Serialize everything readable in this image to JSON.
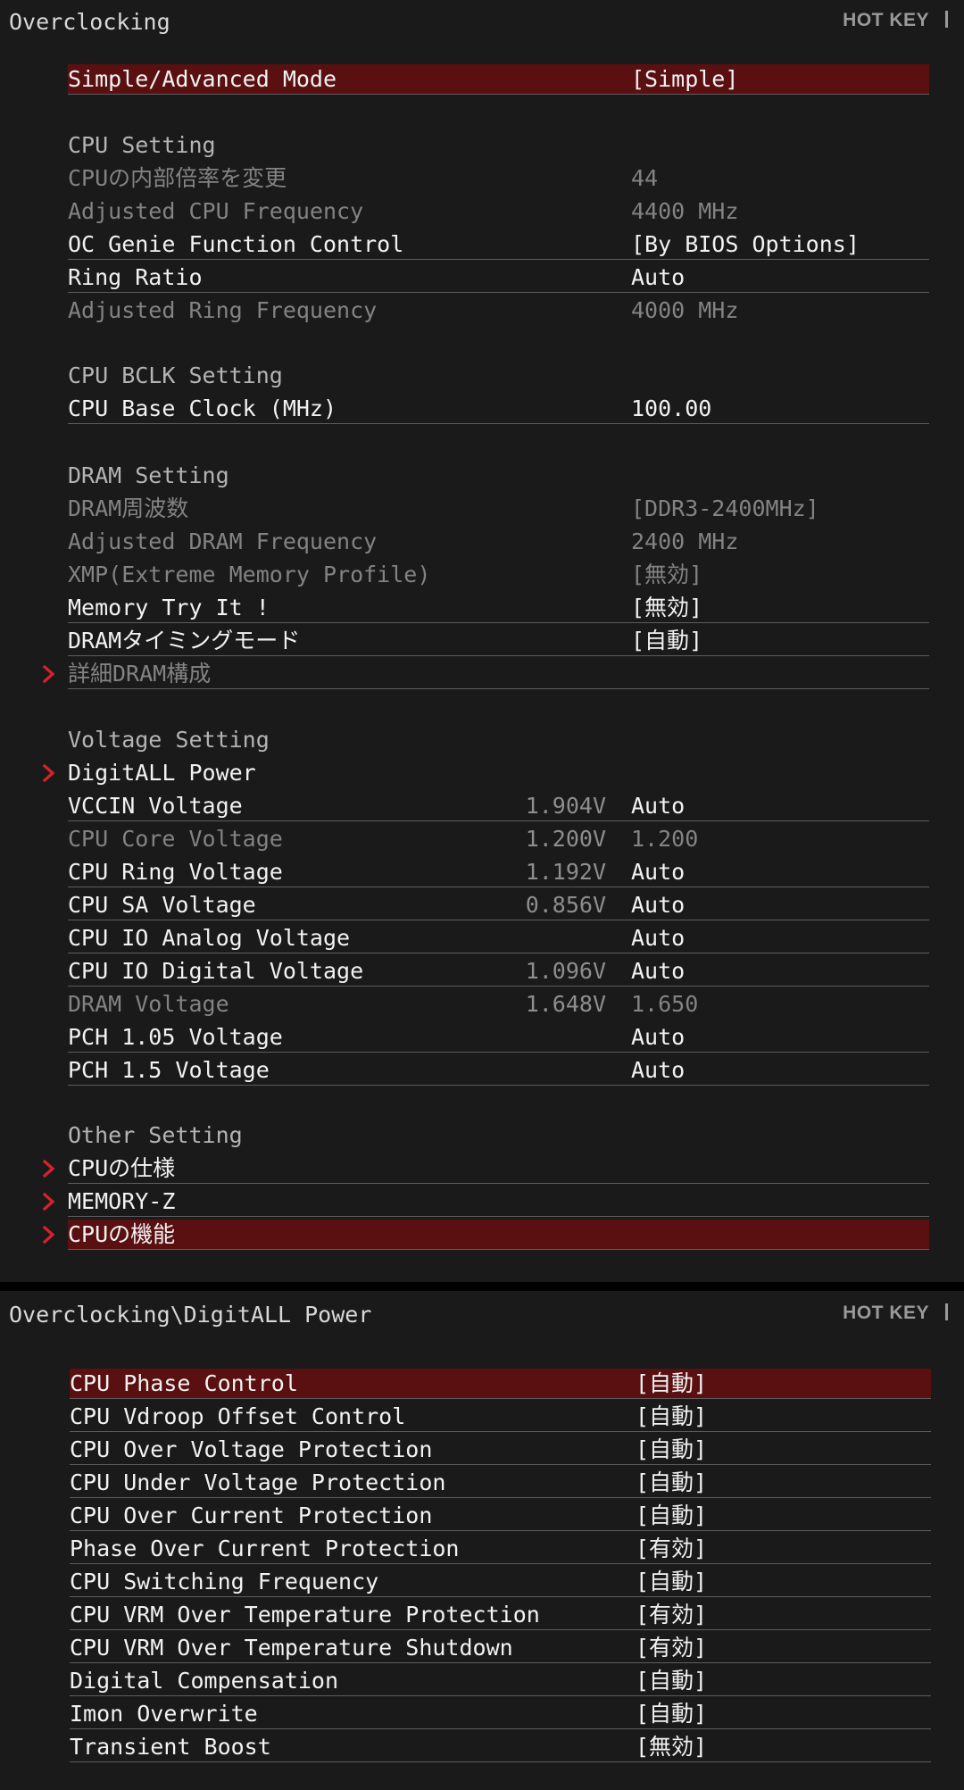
{
  "colors": {
    "panel_bg": "#1a1a1a",
    "selected_bg": "#5a1010",
    "chevron_red": "#d8222a",
    "text_active": "#f2f2f2",
    "text_disabled": "#838383"
  },
  "top_panel": {
    "title": "Overclocking",
    "hotkey": "HOT KEY"
  },
  "bottom_panel": {
    "title": "Overclocking\\DigitALL Power",
    "hotkey": "HOT KEY"
  },
  "settings": {
    "mode": {
      "label": "Simple/Advanced Mode",
      "value": "[Simple]"
    },
    "cpu_header": "CPU Setting",
    "cpu_ratio": {
      "label": "CPUの内部倍率を変更",
      "value": "44"
    },
    "adj_cpu_freq": {
      "label": "Adjusted CPU Frequency",
      "value": "4400 MHz"
    },
    "oc_genie": {
      "label": "OC Genie Function Control",
      "value": "[By BIOS Options]"
    },
    "ring_ratio": {
      "label": "Ring Ratio",
      "value": "Auto"
    },
    "adj_ring_freq": {
      "label": "Adjusted Ring Frequency",
      "value": "4000 MHz"
    },
    "bclk_header": "CPU BCLK Setting",
    "base_clock": {
      "label": "CPU Base Clock (MHz)",
      "value": "100.00"
    },
    "dram_header": "DRAM Setting",
    "dram_freq": {
      "label": "DRAM周波数",
      "value": "[DDR3-2400MHz]"
    },
    "adj_dram_freq": {
      "label": "Adjusted DRAM Frequency",
      "value": "2400 MHz"
    },
    "xmp": {
      "label": "XMP(Extreme Memory Profile)",
      "value": "[無効]"
    },
    "memory_try": {
      "label": "Memory Try It !",
      "value": "[無効]"
    },
    "dram_timing": {
      "label": "DRAMタイミングモード",
      "value": "[自動]"
    },
    "adv_dram": {
      "label": "詳細DRAM構成"
    },
    "voltage_header": "Voltage Setting",
    "digitall_power": {
      "label": "DigitALL Power"
    },
    "vccin": {
      "label": "VCCIN Voltage",
      "current": "1.904V",
      "value": "Auto"
    },
    "cpu_core_v": {
      "label": "CPU Core Voltage",
      "current": "1.200V",
      "value": "1.200"
    },
    "cpu_ring_v": {
      "label": "CPU Ring Voltage",
      "current": "1.192V",
      "value": "Auto"
    },
    "cpu_sa_v": {
      "label": "CPU SA Voltage",
      "current": "0.856V",
      "value": "Auto"
    },
    "cpu_io_analog": {
      "label": "CPU IO Analog Voltage",
      "current": "",
      "value": "Auto"
    },
    "cpu_io_digital": {
      "label": "CPU IO Digital Voltage",
      "current": "1.096V",
      "value": "Auto"
    },
    "dram_v": {
      "label": "DRAM Voltage",
      "current": "1.648V",
      "value": "1.650"
    },
    "pch_105": {
      "label": "PCH 1.05 Voltage",
      "current": "",
      "value": "Auto"
    },
    "pch_15": {
      "label": "PCH 1.5 Voltage",
      "current": "",
      "value": "Auto"
    },
    "other_header": "Other Setting",
    "cpu_spec": {
      "label": "CPUの仕様"
    },
    "memory_z": {
      "label": "MEMORY-Z"
    },
    "cpu_features": {
      "label": "CPUの機能"
    }
  },
  "digitall": {
    "phase_control": {
      "label": "CPU Phase Control",
      "value": "[自動]"
    },
    "vdroop": {
      "label": "CPU Vdroop Offset Control",
      "value": "[自動]"
    },
    "ovp": {
      "label": "CPU Over Voltage Protection",
      "value": "[自動]"
    },
    "uvp": {
      "label": "CPU Under Voltage Protection",
      "value": "[自動]"
    },
    "ocp": {
      "label": "CPU Over Current Protection",
      "value": "[自動]"
    },
    "phase_ocp": {
      "label": "Phase Over Current Protection",
      "value": "[有効]"
    },
    "switching_freq": {
      "label": "CPU Switching Frequency",
      "value": "[自動]"
    },
    "vrm_otp": {
      "label": "CPU VRM Over Temperature Protection",
      "value": "[有効]"
    },
    "vrm_shutdown": {
      "label": "CPU VRM Over Temperature Shutdown",
      "value": "[有効]"
    },
    "digital_comp": {
      "label": "Digital Compensation",
      "value": "[自動]"
    },
    "imon": {
      "label": "Imon Overwrite",
      "value": "[自動]"
    },
    "transient": {
      "label": "Transient Boost",
      "value": "[無効]"
    }
  }
}
